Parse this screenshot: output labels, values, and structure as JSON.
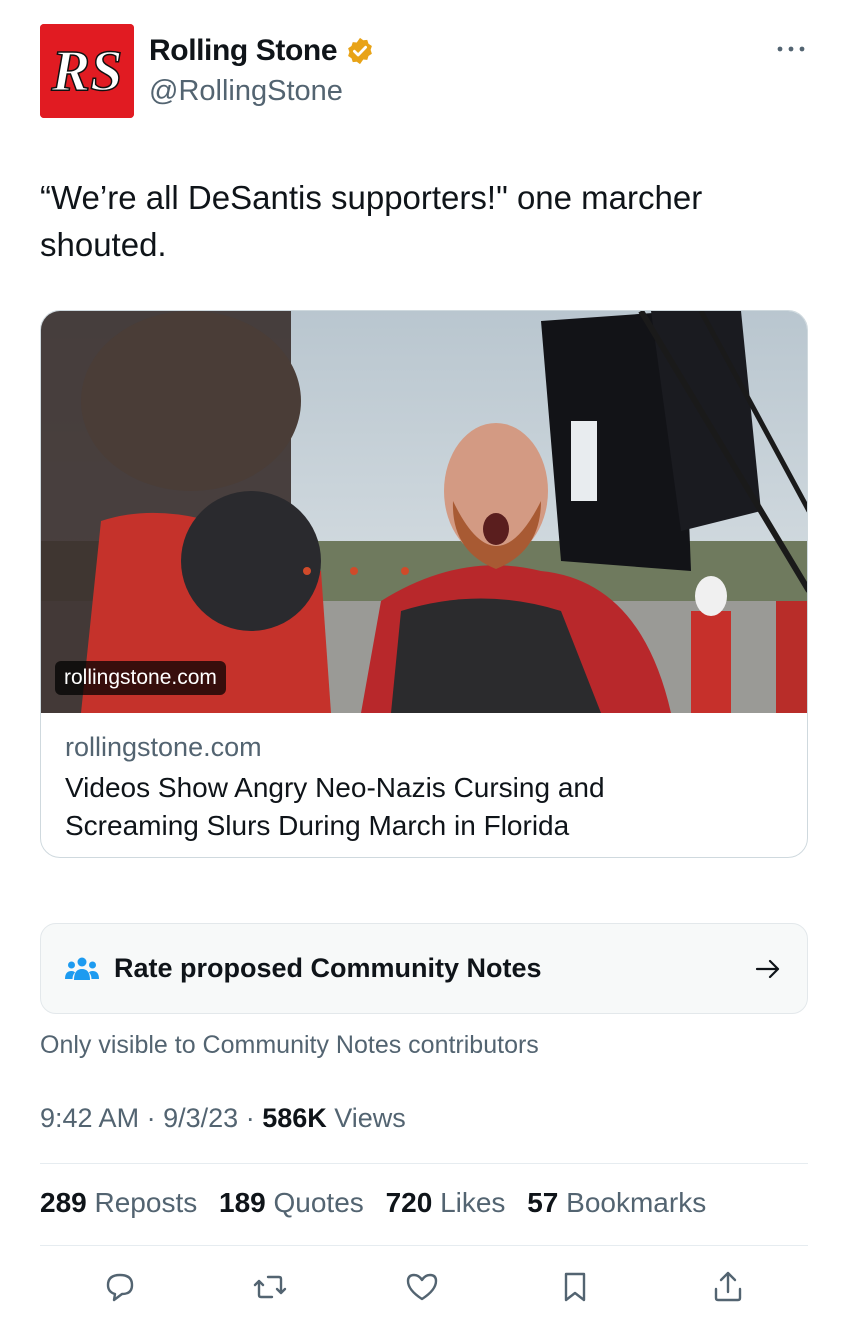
{
  "author": {
    "name": "Rolling Stone",
    "handle": "@RollingStone",
    "avatar_text": "RS",
    "avatar_color": "#e11b22",
    "verified_color": "#e8a317"
  },
  "tweet": {
    "text": "“We’re all DeSantis supporters!\" one marcher shouted."
  },
  "card": {
    "image_badge": "rollingstone.com",
    "domain": "rollingstone.com",
    "title": "Videos Show Angry Neo-Nazis Cursing and Screaming Slurs During March in Florida"
  },
  "community_notes": {
    "label": "Rate proposed Community Notes",
    "subtext": "Only visible to Community Notes contributors",
    "icon_color": "#1d9bf0"
  },
  "meta": {
    "time": "9:42 AM",
    "date": "9/3/23",
    "views_count": "586K",
    "views_label": "Views",
    "separator": "·"
  },
  "stats": [
    {
      "count": "289",
      "label": "Reposts"
    },
    {
      "count": "189",
      "label": "Quotes"
    },
    {
      "count": "720",
      "label": "Likes"
    },
    {
      "count": "57",
      "label": "Bookmarks"
    }
  ],
  "actions": [
    "reply-icon",
    "repost-icon",
    "like-icon",
    "bookmark-icon",
    "share-icon"
  ],
  "colors": {
    "text_primary": "#0f1419",
    "text_secondary": "#536471",
    "border": "#cfd9de"
  }
}
